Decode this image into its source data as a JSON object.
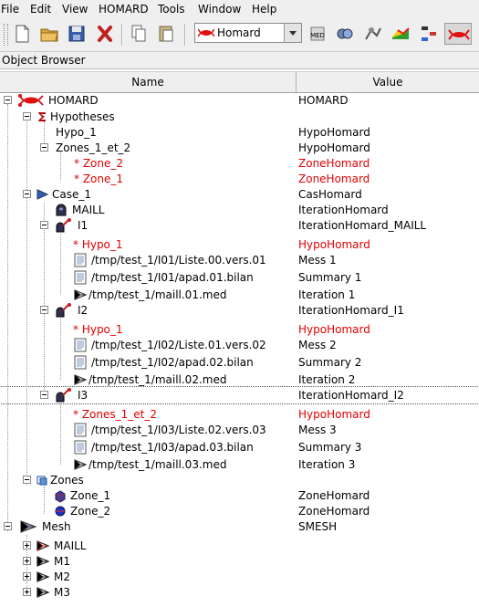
{
  "menubar": {
    "items": [
      {
        "label": "File"
      },
      {
        "label": "Edit"
      },
      {
        "label": "View"
      },
      {
        "label": "HOMARD"
      },
      {
        "label": "Tools"
      },
      {
        "label": "Window"
      },
      {
        "label": "Help"
      }
    ]
  },
  "toolbar": {
    "buttons": [
      "new-document-icon",
      "open-folder-icon",
      "save-icon",
      "close-icon",
      "copy-icon",
      "paste-icon"
    ],
    "module_combo": {
      "selected": "Homard",
      "icon": "homard-lobster-icon"
    },
    "module_buttons": [
      "med-icon",
      "geometry-icon",
      "mesh-icon",
      "post-pro-icon",
      "yacs-icon",
      "homard-icon"
    ]
  },
  "object_browser": {
    "title": "Object Browser",
    "columns": {
      "name": "Name",
      "value": "Value"
    }
  },
  "tree": {
    "rows": [
      {
        "label": "HOMARD",
        "value": "HOMARD"
      },
      {
        "label": "Hypotheses",
        "value": ""
      },
      {
        "label": "Hypo_1",
        "value": "HypoHomard"
      },
      {
        "label": "Zones_1_et_2",
        "value": "HypoHomard"
      },
      {
        "label": "* Zone_2",
        "value": "ZoneHomard"
      },
      {
        "label": "* Zone_1",
        "value": "ZoneHomard"
      },
      {
        "label": "Case_1",
        "value": "CasHomard"
      },
      {
        "label": "MAILL",
        "value": "IterationHomard"
      },
      {
        "label": "I1",
        "value": "IterationHomard_MAILL"
      },
      {
        "label": "* Hypo_1",
        "value": "HypoHomard"
      },
      {
        "label": "/tmp/test_1/I01/Liste.00.vers.01",
        "value": "Mess 1"
      },
      {
        "label": "/tmp/test_1/I01/apad.01.bilan",
        "value": "Summary 1"
      },
      {
        "label": "/tmp/test_1/maill.01.med",
        "value": "Iteration 1"
      },
      {
        "label": "I2",
        "value": "IterationHomard_I1"
      },
      {
        "label": "* Hypo_1",
        "value": "HypoHomard"
      },
      {
        "label": "/tmp/test_1/I02/Liste.01.vers.02",
        "value": "Mess 2"
      },
      {
        "label": "/tmp/test_1/I02/apad.02.bilan",
        "value": "Summary 2"
      },
      {
        "label": "/tmp/test_1/maill.02.med",
        "value": "Iteration 2"
      },
      {
        "label": "I3",
        "value": "IterationHomard_I2"
      },
      {
        "label": "* Zones_1_et_2",
        "value": "HypoHomard"
      },
      {
        "label": "/tmp/test_1/I03/Liste.02.vers.03",
        "value": "Mess 3"
      },
      {
        "label": "/tmp/test_1/I03/apad.03.bilan",
        "value": "Summary 3"
      },
      {
        "label": "/tmp/test_1/maill.03.med",
        "value": "Iteration 3"
      },
      {
        "label": "Zones",
        "value": ""
      },
      {
        "label": "Zone_1",
        "value": "ZoneHomard"
      },
      {
        "label": "Zone_2",
        "value": "ZoneHomard"
      },
      {
        "label": "Mesh",
        "value": "SMESH"
      },
      {
        "label": "MAILL",
        "value": ""
      },
      {
        "label": "M1",
        "value": ""
      },
      {
        "label": "M2",
        "value": ""
      },
      {
        "label": "M3",
        "value": ""
      }
    ]
  },
  "colors": {
    "reference_text": "#e00000",
    "chrome": "#efefef"
  }
}
